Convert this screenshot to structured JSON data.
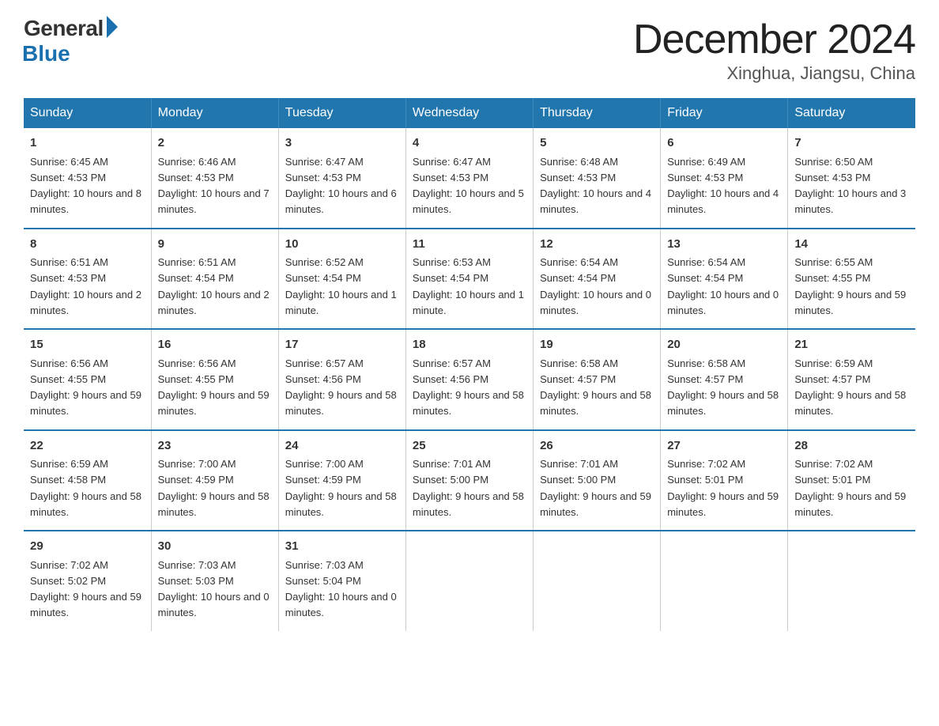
{
  "logo": {
    "general": "General",
    "blue": "Blue"
  },
  "title": "December 2024",
  "subtitle": "Xinghua, Jiangsu, China",
  "days_of_week": [
    "Sunday",
    "Monday",
    "Tuesday",
    "Wednesday",
    "Thursday",
    "Friday",
    "Saturday"
  ],
  "weeks": [
    [
      {
        "num": "1",
        "sunrise": "6:45 AM",
        "sunset": "4:53 PM",
        "daylight": "10 hours and 8 minutes."
      },
      {
        "num": "2",
        "sunrise": "6:46 AM",
        "sunset": "4:53 PM",
        "daylight": "10 hours and 7 minutes."
      },
      {
        "num": "3",
        "sunrise": "6:47 AM",
        "sunset": "4:53 PM",
        "daylight": "10 hours and 6 minutes."
      },
      {
        "num": "4",
        "sunrise": "6:47 AM",
        "sunset": "4:53 PM",
        "daylight": "10 hours and 5 minutes."
      },
      {
        "num": "5",
        "sunrise": "6:48 AM",
        "sunset": "4:53 PM",
        "daylight": "10 hours and 4 minutes."
      },
      {
        "num": "6",
        "sunrise": "6:49 AM",
        "sunset": "4:53 PM",
        "daylight": "10 hours and 4 minutes."
      },
      {
        "num": "7",
        "sunrise": "6:50 AM",
        "sunset": "4:53 PM",
        "daylight": "10 hours and 3 minutes."
      }
    ],
    [
      {
        "num": "8",
        "sunrise": "6:51 AM",
        "sunset": "4:53 PM",
        "daylight": "10 hours and 2 minutes."
      },
      {
        "num": "9",
        "sunrise": "6:51 AM",
        "sunset": "4:54 PM",
        "daylight": "10 hours and 2 minutes."
      },
      {
        "num": "10",
        "sunrise": "6:52 AM",
        "sunset": "4:54 PM",
        "daylight": "10 hours and 1 minute."
      },
      {
        "num": "11",
        "sunrise": "6:53 AM",
        "sunset": "4:54 PM",
        "daylight": "10 hours and 1 minute."
      },
      {
        "num": "12",
        "sunrise": "6:54 AM",
        "sunset": "4:54 PM",
        "daylight": "10 hours and 0 minutes."
      },
      {
        "num": "13",
        "sunrise": "6:54 AM",
        "sunset": "4:54 PM",
        "daylight": "10 hours and 0 minutes."
      },
      {
        "num": "14",
        "sunrise": "6:55 AM",
        "sunset": "4:55 PM",
        "daylight": "9 hours and 59 minutes."
      }
    ],
    [
      {
        "num": "15",
        "sunrise": "6:56 AM",
        "sunset": "4:55 PM",
        "daylight": "9 hours and 59 minutes."
      },
      {
        "num": "16",
        "sunrise": "6:56 AM",
        "sunset": "4:55 PM",
        "daylight": "9 hours and 59 minutes."
      },
      {
        "num": "17",
        "sunrise": "6:57 AM",
        "sunset": "4:56 PM",
        "daylight": "9 hours and 58 minutes."
      },
      {
        "num": "18",
        "sunrise": "6:57 AM",
        "sunset": "4:56 PM",
        "daylight": "9 hours and 58 minutes."
      },
      {
        "num": "19",
        "sunrise": "6:58 AM",
        "sunset": "4:57 PM",
        "daylight": "9 hours and 58 minutes."
      },
      {
        "num": "20",
        "sunrise": "6:58 AM",
        "sunset": "4:57 PM",
        "daylight": "9 hours and 58 minutes."
      },
      {
        "num": "21",
        "sunrise": "6:59 AM",
        "sunset": "4:57 PM",
        "daylight": "9 hours and 58 minutes."
      }
    ],
    [
      {
        "num": "22",
        "sunrise": "6:59 AM",
        "sunset": "4:58 PM",
        "daylight": "9 hours and 58 minutes."
      },
      {
        "num": "23",
        "sunrise": "7:00 AM",
        "sunset": "4:59 PM",
        "daylight": "9 hours and 58 minutes."
      },
      {
        "num": "24",
        "sunrise": "7:00 AM",
        "sunset": "4:59 PM",
        "daylight": "9 hours and 58 minutes."
      },
      {
        "num": "25",
        "sunrise": "7:01 AM",
        "sunset": "5:00 PM",
        "daylight": "9 hours and 58 minutes."
      },
      {
        "num": "26",
        "sunrise": "7:01 AM",
        "sunset": "5:00 PM",
        "daylight": "9 hours and 59 minutes."
      },
      {
        "num": "27",
        "sunrise": "7:02 AM",
        "sunset": "5:01 PM",
        "daylight": "9 hours and 59 minutes."
      },
      {
        "num": "28",
        "sunrise": "7:02 AM",
        "sunset": "5:01 PM",
        "daylight": "9 hours and 59 minutes."
      }
    ],
    [
      {
        "num": "29",
        "sunrise": "7:02 AM",
        "sunset": "5:02 PM",
        "daylight": "9 hours and 59 minutes."
      },
      {
        "num": "30",
        "sunrise": "7:03 AM",
        "sunset": "5:03 PM",
        "daylight": "10 hours and 0 minutes."
      },
      {
        "num": "31",
        "sunrise": "7:03 AM",
        "sunset": "5:04 PM",
        "daylight": "10 hours and 0 minutes."
      },
      {
        "num": "",
        "sunrise": "",
        "sunset": "",
        "daylight": ""
      },
      {
        "num": "",
        "sunrise": "",
        "sunset": "",
        "daylight": ""
      },
      {
        "num": "",
        "sunrise": "",
        "sunset": "",
        "daylight": ""
      },
      {
        "num": "",
        "sunrise": "",
        "sunset": "",
        "daylight": ""
      }
    ]
  ]
}
